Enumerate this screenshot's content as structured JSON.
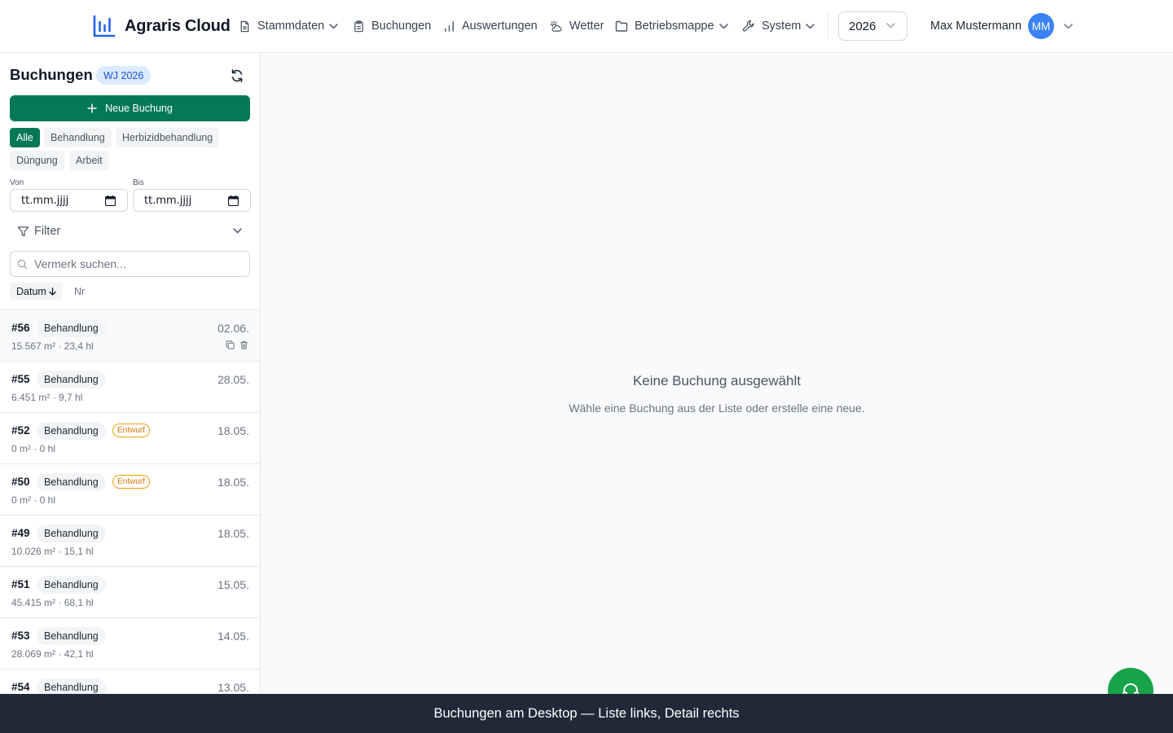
{
  "app": {
    "name": "Agraris Cloud",
    "logo_icon": "bar-chart-icon",
    "brand_color": "#2563eb",
    "accent_color": "#047857"
  },
  "nav": {
    "items": [
      {
        "label": "Stammdaten",
        "icon": "file-text-icon",
        "has_dropdown": true
      },
      {
        "label": "Buchungen",
        "icon": "clipboard-icon",
        "has_dropdown": false
      },
      {
        "label": "Auswertungen",
        "icon": "bar-chart-icon",
        "has_dropdown": false
      },
      {
        "label": "Wetter",
        "icon": "cloud-sun-icon",
        "has_dropdown": false
      },
      {
        "label": "Betriebsmappe",
        "icon": "folder-icon",
        "has_dropdown": true
      },
      {
        "label": "System",
        "icon": "wrench-icon",
        "has_dropdown": true
      }
    ],
    "year": "2026",
    "user_name": "Max Mustermann",
    "user_initials": "MM"
  },
  "sidebar": {
    "title": "Buchungen",
    "badge": "WJ 2026",
    "new_button": "Neue Buchung",
    "type_filters": [
      {
        "label": "Alle",
        "active": true
      },
      {
        "label": "Behandlung",
        "active": false
      },
      {
        "label": "Herbizidbehandlung",
        "active": false
      },
      {
        "label": "Düngung",
        "active": false
      },
      {
        "label": "Arbeit",
        "active": false
      }
    ],
    "date_from_label": "Von",
    "date_from_placeholder": "tt.mm.jjjj",
    "date_to_label": "Bis",
    "date_to_placeholder": "tt.mm.jjjj",
    "filter_label": "Filter",
    "search_placeholder": "Vermerk suchen...",
    "sort": {
      "date_label": "Datum",
      "date_direction": "desc",
      "nr_label": "Nr"
    },
    "bookings": [
      {
        "nr": "#56",
        "type": "Behandlung",
        "draft": "",
        "date": "02.06.",
        "meta": "15.567 m² · 23,4 hl",
        "selected": true
      },
      {
        "nr": "#55",
        "type": "Behandlung",
        "draft": "",
        "date": "28.05.",
        "meta": "6.451 m² · 9,7 hl",
        "selected": false
      },
      {
        "nr": "#52",
        "type": "Behandlung",
        "draft": "Entwurf",
        "date": "18.05.",
        "meta": "0 m² · 0 hl",
        "selected": false
      },
      {
        "nr": "#50",
        "type": "Behandlung",
        "draft": "Entwurf",
        "date": "18.05.",
        "meta": "0 m² · 0 hl",
        "selected": false
      },
      {
        "nr": "#49",
        "type": "Behandlung",
        "draft": "",
        "date": "18.05.",
        "meta": "10.026 m² · 15,1 hl",
        "selected": false
      },
      {
        "nr": "#51",
        "type": "Behandlung",
        "draft": "",
        "date": "15.05.",
        "meta": "45.415 m² · 68,1 hl",
        "selected": false
      },
      {
        "nr": "#53",
        "type": "Behandlung",
        "draft": "",
        "date": "14.05.",
        "meta": "28.069 m² · 42,1 hl",
        "selected": false
      },
      {
        "nr": "#54",
        "type": "Behandlung",
        "draft": "",
        "date": "13.05.",
        "meta": "",
        "selected": false
      }
    ]
  },
  "main": {
    "empty_title": "Keine Buchung ausgewählt",
    "empty_subtitle": "Wähle eine Buchung aus der Liste oder erstelle eine neue."
  },
  "support_icon": "headset-icon",
  "caption": "Buchungen am Desktop — Liste links, Detail rechts"
}
